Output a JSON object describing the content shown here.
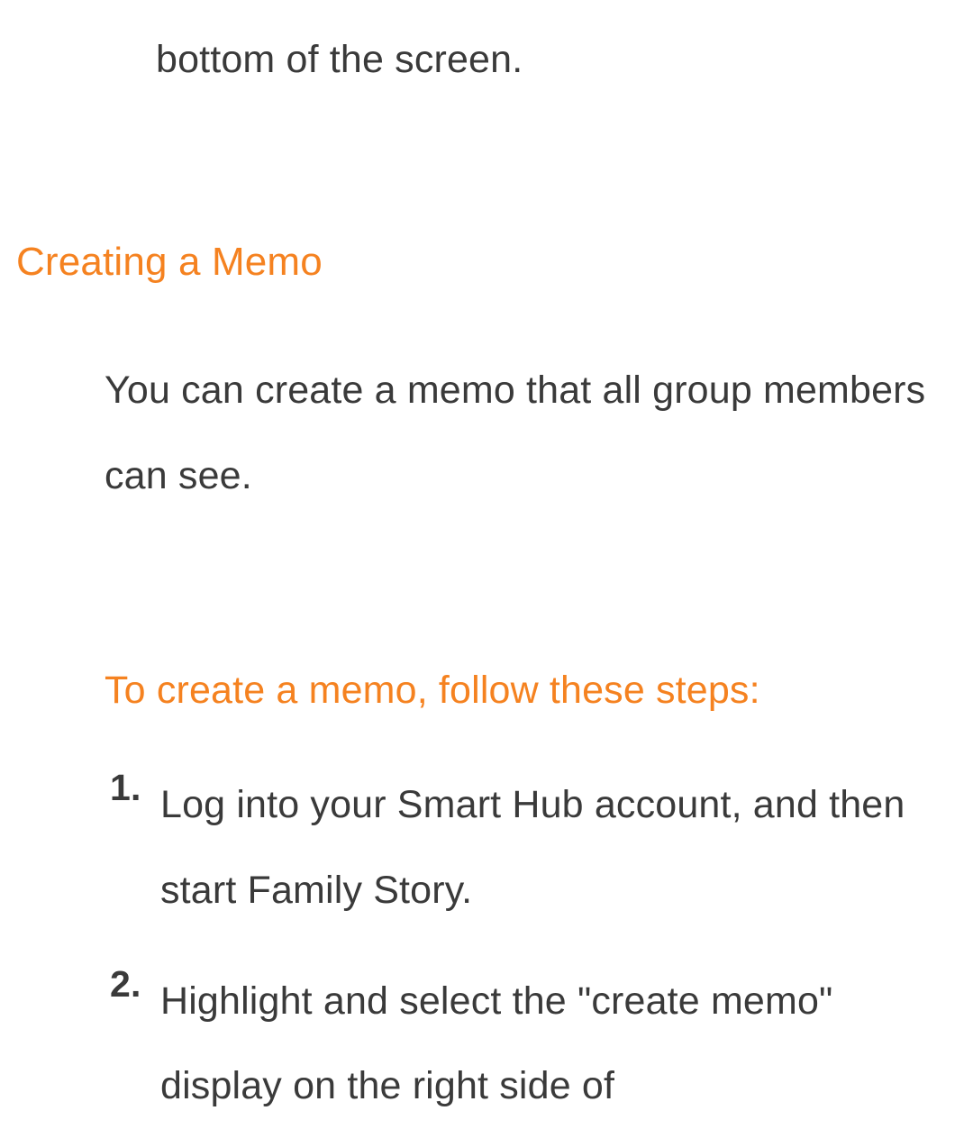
{
  "fragment_line": "bottom of the screen.",
  "section": {
    "heading": "Creating a Memo",
    "intro": "You can create a memo that all group members can see.",
    "subheading": "To create a memo, follow these steps:",
    "steps": [
      {
        "number": "1.",
        "text": "Log into your Smart Hub account, and then start Family Story."
      },
      {
        "number": "2.",
        "text": "Highlight and select the \"create memo\" display on the right side of"
      }
    ]
  }
}
